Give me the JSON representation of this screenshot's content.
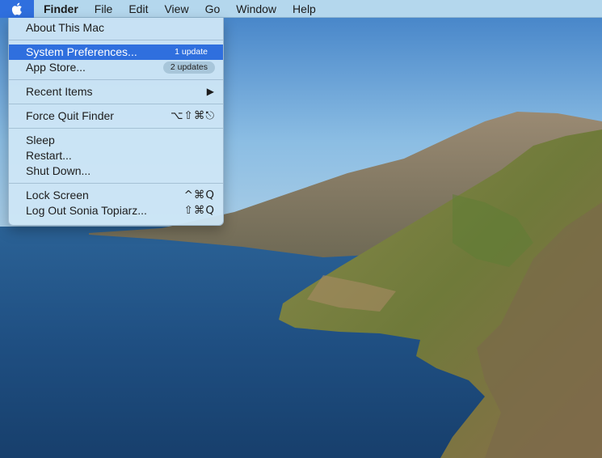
{
  "menubar": {
    "apple_icon": "apple-logo-icon",
    "items": [
      "Finder",
      "File",
      "Edit",
      "View",
      "Go",
      "Window",
      "Help"
    ]
  },
  "apple_menu": {
    "about": "About This Mac",
    "system_prefs": {
      "label": "System Preferences...",
      "badge": "1 update"
    },
    "app_store": {
      "label": "App Store...",
      "badge": "2 updates"
    },
    "recent_items": {
      "label": "Recent Items",
      "arrow": "▶"
    },
    "force_quit": {
      "label": "Force Quit Finder",
      "shortcut": "⌥⇧⌘⎋"
    },
    "sleep": "Sleep",
    "restart": "Restart...",
    "shut_down": "Shut Down...",
    "lock_screen": {
      "label": "Lock Screen",
      "shortcut": "^⌘Q"
    },
    "log_out": {
      "label": "Log Out Sonia Topiarz...",
      "shortcut": "⇧⌘Q"
    }
  },
  "colors": {
    "highlight": "#2f6fde",
    "menu_bg": "#cde6f5"
  }
}
